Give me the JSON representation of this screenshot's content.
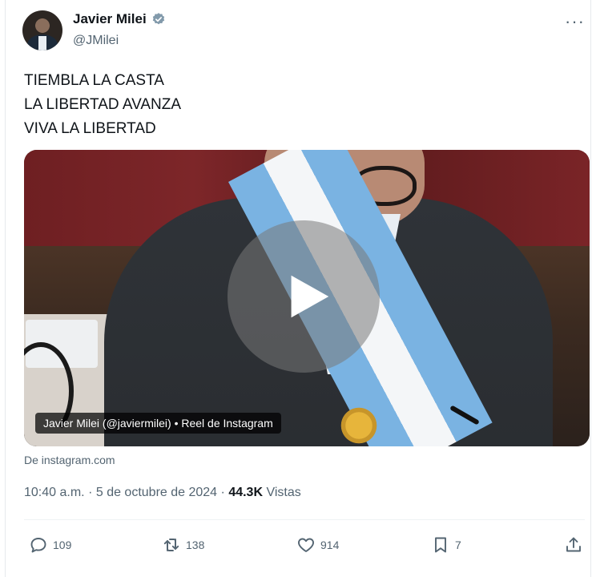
{
  "author": {
    "name": "Javier Milei",
    "handle": "@JMilei",
    "verified": true
  },
  "tweet": {
    "lines": [
      "TIEMBLA LA CASTA",
      "LA LIBERTAD AVANZA",
      "VIVA LA LIBERTAD"
    ]
  },
  "media": {
    "caption": "Javier Milei (@javiermilei) • Reel de Instagram",
    "source": "De instagram.com"
  },
  "meta": {
    "time": "10:40 a.m.",
    "separator": "·",
    "date": "5 de octubre de 2024",
    "views_count": "44.3K",
    "views_label": "Vistas"
  },
  "actions": {
    "replies": "109",
    "retweets": "138",
    "likes": "914",
    "bookmarks": "7"
  },
  "icons": {
    "more": "more-dots-icon",
    "verified": "verified-badge-icon",
    "play": "play-icon",
    "reply": "reply-icon",
    "retweet": "retweet-icon",
    "like": "heart-icon",
    "bookmark": "bookmark-icon",
    "share": "share-icon"
  },
  "colors": {
    "text": "#0f1419",
    "secondary": "#536471",
    "verified": "#829aab"
  }
}
